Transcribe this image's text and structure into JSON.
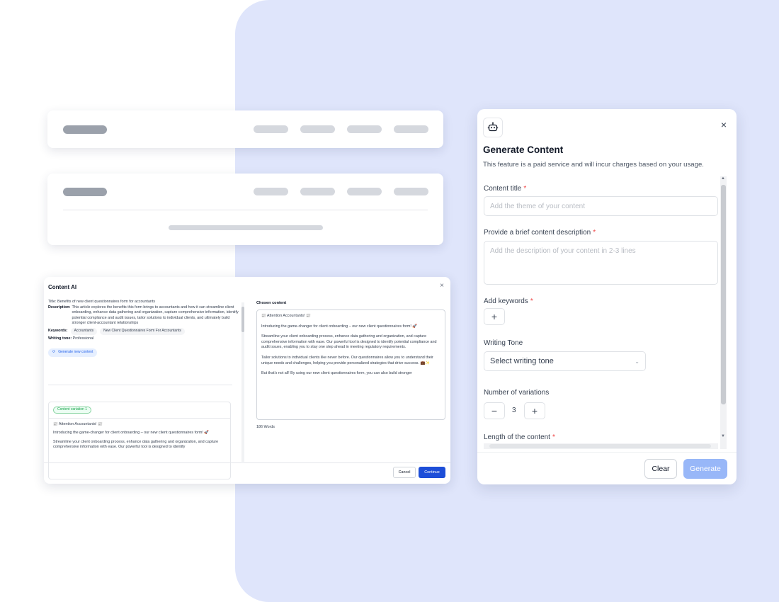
{
  "content_ai": {
    "title": "Content AI",
    "close": "×",
    "left": {
      "title_label": "Title:",
      "title_value": "Benefits of new client questionnaires form for accountants",
      "description_label": "Description:",
      "description_value": "This article explores the benefits this form brings to accountants and how it can streamline client onboarding, enhance data gathering and organization, capture comprehensive information, identify potential compliance and audit issues, tailor solutions to individual clients, and ultimately build stronger client-accountant relationships",
      "keywords_label": "Keywords:",
      "keywords": [
        "Accountants",
        "New Client Questionnaires Form For Accountants"
      ],
      "tone_label": "Writing tone:",
      "tone_value": "Professional",
      "generate_new": "Generate new content"
    },
    "variation": {
      "badge": "Content variation 1",
      "heading": "📰 Attention Accountants! 📰",
      "p1": "Introducing the game-changer for client onboarding – our new client questionnaires form! 🚀",
      "p2": "Streamline your client onboarding process, enhance data gathering and organization, and capture comprehensive information with ease. Our powerful tool is designed to identify"
    },
    "chosen": {
      "title": "Chosen content",
      "heading": "📰 Attention Accountants! 📰",
      "p1": "Introducing the game-changer for client onboarding – our new client questionnaires form! 🚀",
      "p2": "Streamline your client onboarding process, enhance data gathering and organization, and capture comprehensive information with ease. Our powerful tool is designed to identify potential compliance and audit issues, enabling you to stay one step ahead in meeting regulatory requirements.",
      "p3": "Tailor solutions to individual clients like never before. Our questionnaires allow you to understand their unique needs and challenges, helping you provide personalized strategies that drive success. 💼✨",
      "p4": "But that's not all! By using our new client questionnaires form, you can also build stronger",
      "word_count": "186 Words"
    },
    "buttons": {
      "cancel": "Cancel",
      "continue": "Continue"
    }
  },
  "generate_content": {
    "title": "Generate Content",
    "subtitle": "This feature is a paid service and will incur charges based on your usage.",
    "close": "×",
    "fields": {
      "content_title_label": "Content title",
      "content_title_placeholder": "Add the theme of your content",
      "description_label": "Provide a brief content description",
      "description_placeholder": "Add the description of your content in 2-3 lines",
      "keywords_label": "Add keywords",
      "tone_label": "Writing Tone",
      "tone_placeholder": "Select writing tone",
      "variations_label": "Number of variations",
      "variations_value": "3",
      "length_label": "Length of the content"
    },
    "required_mark": "*",
    "buttons": {
      "clear": "Clear",
      "generate": "Generate"
    }
  }
}
